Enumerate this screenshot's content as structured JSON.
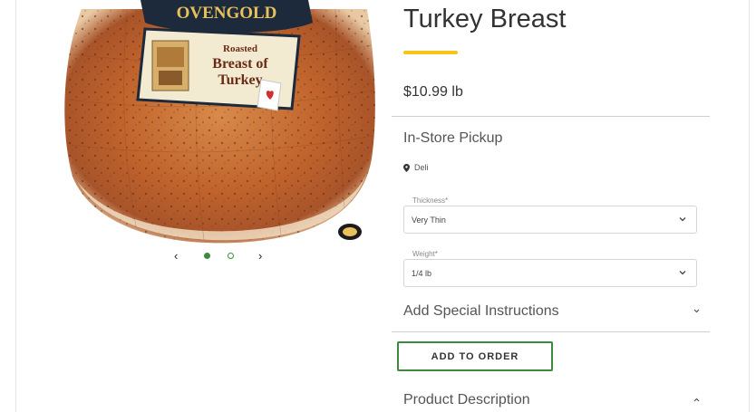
{
  "product": {
    "title": "Turkey Breast",
    "price": "$10.99 lb",
    "accent_color": "#f5c518",
    "image": {
      "brand_text": "OVENGOLD",
      "label_line1": "Roasted",
      "label_line2": "Breast of",
      "label_line3": "Turkey"
    }
  },
  "carousel": {
    "prev_icon": "chevron-left-icon",
    "next_icon": "chevron-right-icon",
    "prev_glyph": "‹",
    "next_glyph": "›",
    "slide_count": 2,
    "active_slide": 1,
    "active_color": "#3d8b3d"
  },
  "pickup": {
    "heading": "In-Store Pickup",
    "location_icon": "map-pin-icon",
    "location": "Deli"
  },
  "options": {
    "thickness": {
      "label": "Thickness*",
      "value": "Very Thin"
    },
    "weight": {
      "label": "Weight*",
      "value": "1/4 lb"
    }
  },
  "accordions": {
    "special_instructions": {
      "label": "Add Special Instructions",
      "state": "collapsed"
    },
    "description": {
      "label": "Product Description",
      "state": "expanded"
    }
  },
  "actions": {
    "add_to_order": "ADD TO ORDER",
    "button_color": "#3d8b3d"
  }
}
